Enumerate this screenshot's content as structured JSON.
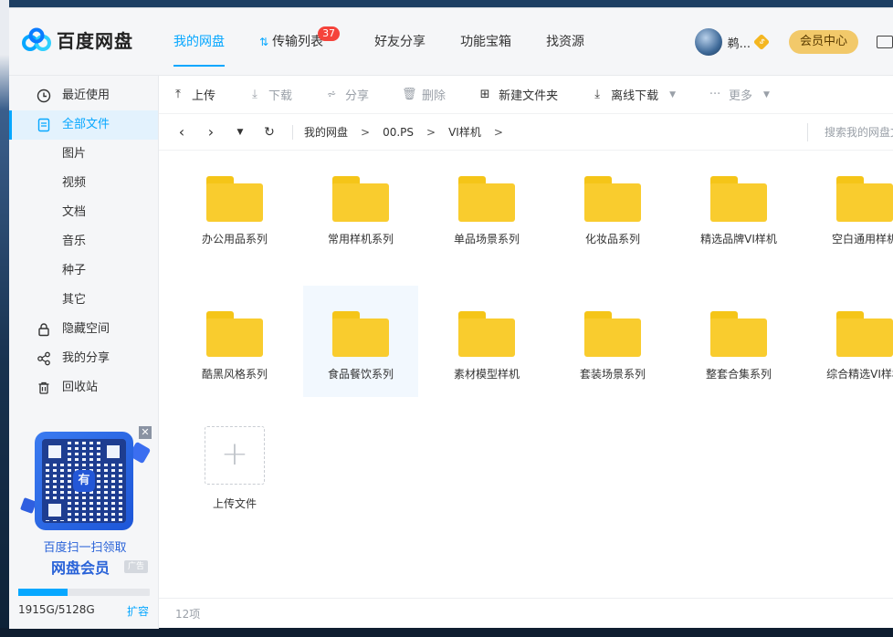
{
  "app": {
    "name": "百度网盘",
    "brand_color": "#06a7ff"
  },
  "nav": {
    "items": [
      {
        "label": "我的网盘",
        "active": true
      },
      {
        "label": "传输列表",
        "badge": "37"
      },
      {
        "label": "好友分享"
      },
      {
        "label": "功能宝箱"
      },
      {
        "label": "找资源"
      }
    ]
  },
  "user": {
    "name": "鹈...",
    "vip_label": "会员中心"
  },
  "sidebar": {
    "items": [
      {
        "label": "最近使用",
        "icon": "clock-icon"
      },
      {
        "label": "全部文件",
        "icon": "file-icon",
        "active": true
      },
      {
        "label": "图片"
      },
      {
        "label": "视频"
      },
      {
        "label": "文档"
      },
      {
        "label": "音乐"
      },
      {
        "label": "种子"
      },
      {
        "label": "其它"
      },
      {
        "label": "隐藏空间",
        "icon": "lock-icon"
      },
      {
        "label": "我的分享",
        "icon": "share-icon"
      },
      {
        "label": "回收站",
        "icon": "trash-icon"
      }
    ],
    "promo": {
      "line1": "百度扫一扫领取",
      "line2": "网盘会员",
      "ad": "广告",
      "qr_logo": "有"
    },
    "quota": {
      "text": "1915G/5128G",
      "used_fraction": 0.373,
      "expand_label": "扩容"
    }
  },
  "toolbar": {
    "upload": "上传",
    "download": "下载",
    "share": "分享",
    "delete": "删除",
    "new_folder": "新建文件夹",
    "offline_download": "离线下载",
    "more": "更多"
  },
  "path": {
    "crumbs": [
      "我的网盘",
      "00.PS",
      "VI样机"
    ],
    "search_placeholder": "搜索我的网盘文件"
  },
  "folders": [
    "办公用品系列",
    "常用样机系列",
    "单品场景系列",
    "化妆品系列",
    "精选品牌VI样机",
    "空白通用样机",
    "酷黑风格系列",
    "食品餐饮系列",
    "素材模型样机",
    "套装场景系列",
    "整套合集系列",
    "综合精选VI样机"
  ],
  "upload_tile_label": "上传文件",
  "status": {
    "count": "12项"
  }
}
